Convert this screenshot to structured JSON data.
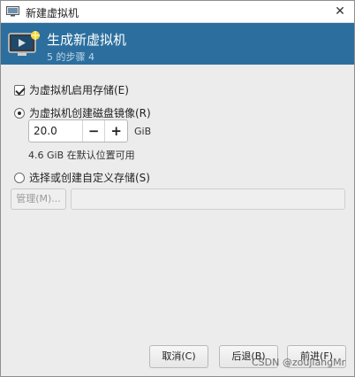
{
  "window": {
    "title": "新建虚拟机",
    "close_glyph": "✕"
  },
  "header": {
    "title": "生成新虚拟机",
    "subtitle": "5 的步骤 4",
    "icon": "monitor-play-icon",
    "background": "#2c6f9e"
  },
  "storage": {
    "enable_label": "为虚拟机启用存储(E)",
    "enable_checked": true,
    "create_disk_label": "为虚拟机创建磁盘镜像(R)",
    "create_disk_selected": true,
    "disk_size_value": "20.0",
    "decrement_glyph": "−",
    "increment_glyph": "+",
    "disk_size_unit": "GiB",
    "free_space_text": "4.6 GiB 在默认位置可用",
    "custom_label": "选择或创建自定义存储(S)",
    "custom_selected": false,
    "manage_label": "管理(M)...",
    "custom_path_value": ""
  },
  "buttons": {
    "cancel": "取消(C)",
    "back": "后退(B)",
    "forward": "前进(F)"
  },
  "watermark": "CSDN @zoujiangMr"
}
